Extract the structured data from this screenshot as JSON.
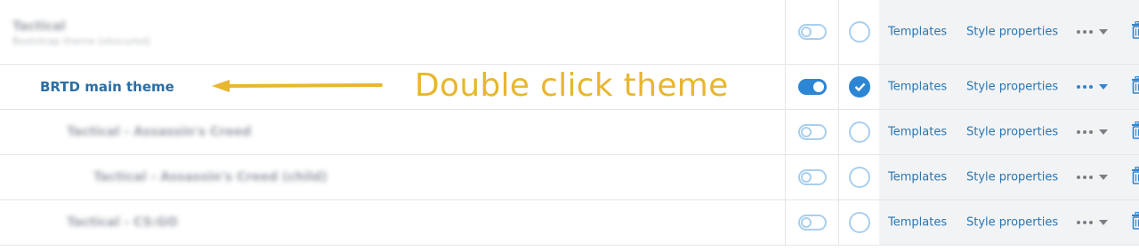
{
  "annotation": {
    "text": "Double click theme",
    "color": "#e8b62f"
  },
  "colors": {
    "accent": "#2c86d4",
    "link": "#2a76b0",
    "inactive": "#a9cfee"
  },
  "rows": [
    {
      "name": "Tactical",
      "subtitle": "Bootstrap theme (obscured)",
      "obscured": true,
      "enabled": false,
      "default": false,
      "templates_label": "Templates",
      "style_label": "Style properties"
    },
    {
      "name": "BRTD main theme",
      "obscured": false,
      "enabled": true,
      "default": true,
      "templates_label": "Templates",
      "style_label": "Style properties"
    },
    {
      "name": "Tactical - Assassin's Creed",
      "obscured": true,
      "enabled": false,
      "default": false,
      "templates_label": "Templates",
      "style_label": "Style properties"
    },
    {
      "name": "Tactical - Assassin's Creed (child)",
      "obscured": true,
      "enabled": false,
      "default": false,
      "templates_label": "Templates",
      "style_label": "Style properties"
    },
    {
      "name": "Tactical - CS:GO",
      "obscured": true,
      "enabled": false,
      "default": false,
      "templates_label": "Templates",
      "style_label": "Style properties"
    }
  ],
  "icons": {
    "more": "ellipsis-icon",
    "dropdown": "caret-down-icon",
    "delete": "trash-icon",
    "toggle": "toggle-switch-icon",
    "default": "radio-check-icon"
  }
}
